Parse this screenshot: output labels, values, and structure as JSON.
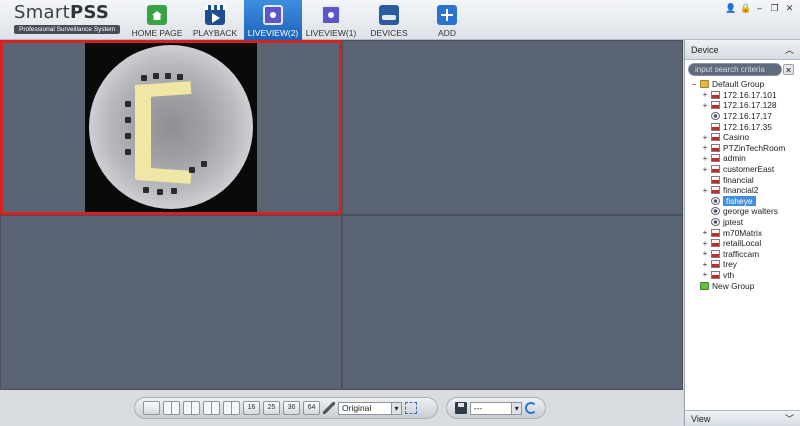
{
  "app": {
    "name_light": "Smart",
    "name_bold": "PSS",
    "subtitle": "Professional Surveillance System"
  },
  "tabs": [
    {
      "label": "HOME PAGE",
      "icon": "home-icon"
    },
    {
      "label": "PLAYBACK",
      "icon": "playback-icon"
    },
    {
      "label": "LIVEVIEW(2)",
      "icon": "liveview-icon"
    },
    {
      "label": "LIVEVIEW(1)",
      "icon": "liveview-icon"
    },
    {
      "label": "DEVICES",
      "icon": "devices-icon"
    },
    {
      "label": "ADD",
      "icon": "add-icon"
    }
  ],
  "active_tab": 2,
  "window_controls": {
    "user": "👤",
    "lock": "🔒",
    "minimize": "–",
    "restore": "❐",
    "close": "✕"
  },
  "toolbar": {
    "layout_buttons": [
      "",
      "",
      "",
      "",
      "",
      "16",
      "25",
      "36",
      "64"
    ],
    "aspect_value": "Original",
    "preset_value": "---"
  },
  "device_panel": {
    "title": "Device",
    "search_placeholder": "input search criteria",
    "footer": "View",
    "tree": [
      {
        "label": "Default Group",
        "exp": "−",
        "type": "group",
        "indent": 0
      },
      {
        "label": "172.16.17.101",
        "exp": "+",
        "type": "dvr",
        "indent": 1
      },
      {
        "label": "172.16.17.128",
        "exp": "+",
        "type": "dvr",
        "indent": 1
      },
      {
        "label": "172.16.17.17",
        "exp": "",
        "type": "cam",
        "indent": 1
      },
      {
        "label": "172.16.17.35",
        "exp": "",
        "type": "dvr",
        "indent": 1
      },
      {
        "label": "Casino",
        "exp": "+",
        "type": "dvr",
        "indent": 1
      },
      {
        "label": "PTZinTechRoom",
        "exp": "+",
        "type": "dvr",
        "indent": 1
      },
      {
        "label": "admin",
        "exp": "+",
        "type": "dvr",
        "indent": 1
      },
      {
        "label": "customerEast",
        "exp": "+",
        "type": "dvr",
        "indent": 1
      },
      {
        "label": "financial",
        "exp": "",
        "type": "dvr",
        "indent": 1
      },
      {
        "label": "financial2",
        "exp": "+",
        "type": "dvr",
        "indent": 1
      },
      {
        "label": "fisheye",
        "exp": "",
        "type": "cam",
        "indent": 1,
        "selected": true
      },
      {
        "label": "george walters",
        "exp": "",
        "type": "cam",
        "indent": 1
      },
      {
        "label": "jptest",
        "exp": "",
        "type": "cam",
        "indent": 1
      },
      {
        "label": "m70Matrix",
        "exp": "+",
        "type": "dvr",
        "indent": 1
      },
      {
        "label": "retailLocal",
        "exp": "+",
        "type": "dvr",
        "indent": 1
      },
      {
        "label": "trafficcam",
        "exp": "+",
        "type": "dvr",
        "indent": 1
      },
      {
        "label": "trey",
        "exp": "+",
        "type": "dvr",
        "indent": 1
      },
      {
        "label": "vth",
        "exp": "+",
        "type": "dvr",
        "indent": 1
      },
      {
        "label": "New Group",
        "exp": "",
        "type": "newgroup",
        "indent": 0
      }
    ]
  },
  "colors": {
    "active_tab": "#1d63b9",
    "selected_pane_border": "#d42222",
    "video_bg": "#5b6473",
    "tree_selection": "#3f8ee0"
  }
}
